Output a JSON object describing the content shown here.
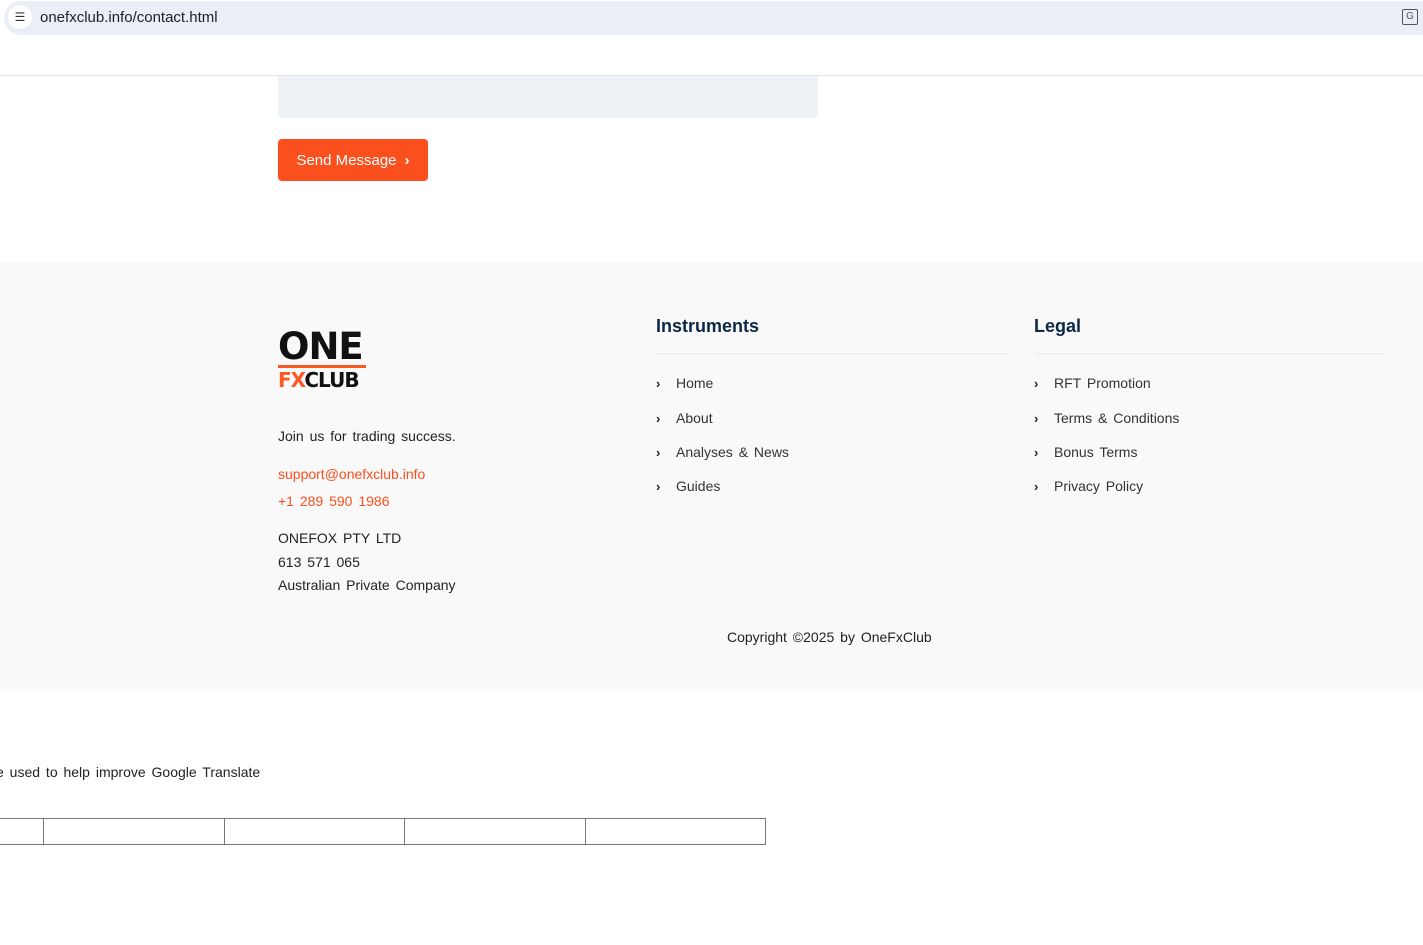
{
  "browser": {
    "url": "onefxclub.info/contact.html",
    "site_settings_icon": "tune-icon",
    "translate_icon": "translate-icon"
  },
  "form": {
    "send_label": "Send Message",
    "send_icon": "chevron-right-icon"
  },
  "footer": {
    "logo": {
      "line1": "ONE",
      "line2_accent": "FX",
      "line2": "CLUB"
    },
    "tagline": "Join us for trading success.",
    "email": "support@onefxclub.info",
    "phone": "+1 289 590 1986",
    "company": [
      "ONEFOX PTY LTD",
      "613 571 065",
      "Australian Private Company"
    ],
    "columns": [
      {
        "title": "Instruments",
        "items": [
          "Home",
          "About",
          "Analyses & News",
          "Guides"
        ]
      },
      {
        "title": "Legal",
        "items": [
          "RFT Promotion",
          "Terms & Conditions",
          "Bonus Terms",
          "Privacy Policy"
        ]
      }
    ],
    "copyright": "Copyright ©2025 by OneFxClub"
  },
  "google_translate": {
    "text": "e used to help improve Google Translate"
  },
  "colors": {
    "accent": "#fb4f1d",
    "heading": "#0d2746",
    "footer_bg": "#f9f9f9"
  }
}
